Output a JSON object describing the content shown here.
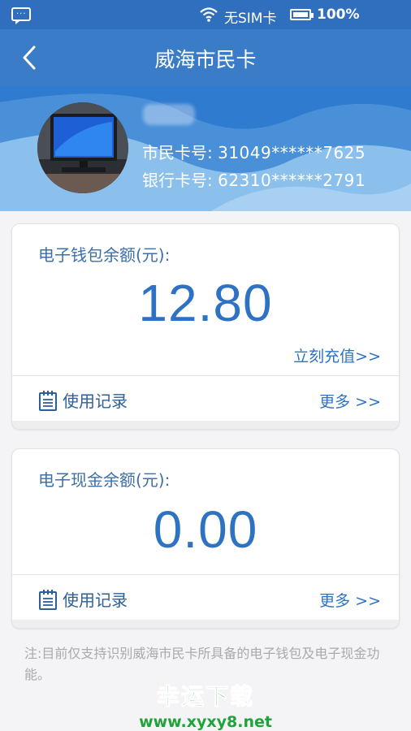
{
  "status_bar": {
    "sim_status": "无SIM卡",
    "battery": "100%",
    "icons": [
      "message-icon",
      "wifi-icon",
      "battery-icon"
    ]
  },
  "header": {
    "title": "威海市民卡",
    "back_icon": "chevron-left-icon"
  },
  "profile": {
    "citizen_card_label": "市民卡号:",
    "citizen_card_number": "31049******7625",
    "bank_card_label": "银行卡号:",
    "bank_card_number": "62310******2791"
  },
  "wallet": {
    "label": "电子钱包余额(元):",
    "balance": "12.80",
    "recharge_link": "立刻充值>>",
    "record_link": "使用记录",
    "more_link": "更多 >>"
  },
  "cash": {
    "label": "电子现金余额(元):",
    "balance": "0.00",
    "record_link": "使用记录",
    "more_link": "更多 >>"
  },
  "note": "注:目前仅支持识别威海市民卡所具备的电子钱包及电子现金功能。",
  "watermark": {
    "title": "幸运下载",
    "url": "www.xyxy8.net"
  },
  "colors": {
    "header_blue": "#3a7cc8",
    "accent_blue": "#2e72c4",
    "watermark_green": "#1fa33a"
  }
}
